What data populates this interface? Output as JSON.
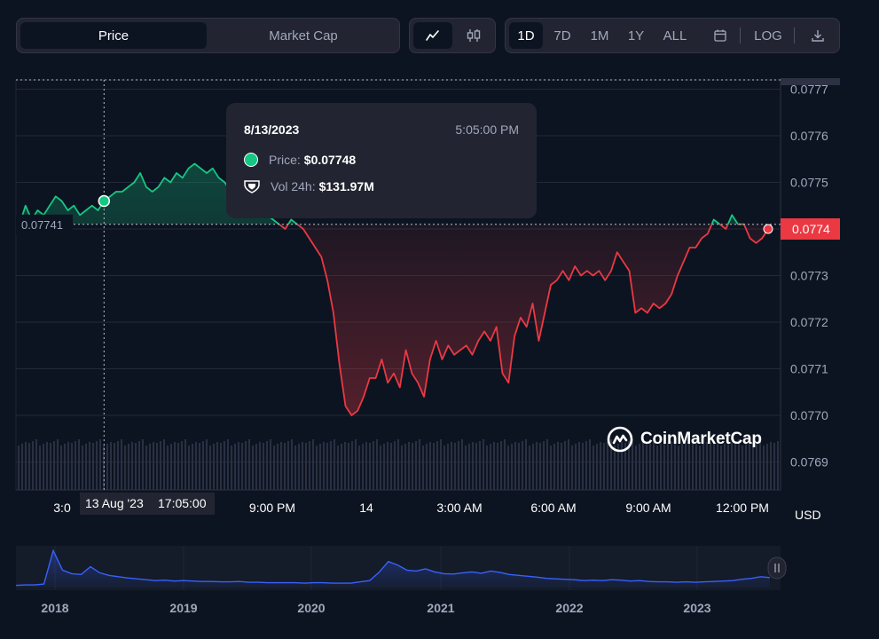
{
  "toolbar": {
    "type_tabs": [
      {
        "label": "Price",
        "active": true
      },
      {
        "label": "Market Cap",
        "active": false
      }
    ],
    "chart_type_buttons": [
      {
        "icon": "line-chart-icon",
        "active": true
      },
      {
        "icon": "candlestick-icon",
        "active": false
      }
    ],
    "range_tabs": [
      {
        "label": "1D",
        "active": true
      },
      {
        "label": "7D",
        "active": false
      },
      {
        "label": "1M",
        "active": false
      },
      {
        "label": "1Y",
        "active": false
      },
      {
        "label": "ALL",
        "active": false
      }
    ],
    "calendar_icon": "calendar-icon",
    "log_label": "LOG",
    "download_icon": "download-icon"
  },
  "tooltip": {
    "date": "8/13/2023",
    "time": "5:05:00 PM",
    "price_label": "Price:",
    "price_value": "$0.07748",
    "vol_label": "Vol 24h:",
    "vol_value": "$131.97M"
  },
  "watermark": "CoinMarketCap",
  "currency_label": "USD",
  "colors": {
    "background": "#0d1421",
    "panel": "#222531",
    "up": "#16c784",
    "down": "#ea3943",
    "nav_line": "#3861fb"
  },
  "chart_data": [
    {
      "type": "line",
      "title": "",
      "ylim": [
        0.07684,
        0.07772
      ],
      "yticks": [
        0.0769,
        0.077,
        0.0771,
        0.0772,
        0.0773,
        0.0774,
        0.0775,
        0.0776,
        0.0777
      ],
      "xticks": [
        "3:0",
        "9:00 PM",
        "14",
        "3:00 AM",
        "6:00 AM",
        "9:00 AM",
        "12:00 PM"
      ],
      "y_axis_position": "right",
      "reference_price_label": "0.07741",
      "reference_price": 0.07741,
      "current_price_label": "0.0774",
      "current_price": 0.0774,
      "crosshair_label": "13 Aug '23",
      "crosshair_time": "17:05:00",
      "series": [
        {
          "values": [
            0.07741,
            0.07745,
            0.07742,
            0.07744,
            0.07743,
            0.07745,
            0.07747,
            0.07746,
            0.07744,
            0.07745,
            0.07743,
            0.07744,
            0.07745,
            0.07744,
            0.07746,
            0.07747,
            0.07748,
            0.07748,
            0.07749,
            0.0775,
            0.07752,
            0.07749,
            0.07748,
            0.07749,
            0.07751,
            0.0775,
            0.07752,
            0.07751,
            0.07753,
            0.07754,
            0.07753,
            0.07752,
            0.07753,
            0.07751,
            0.0775,
            0.07748,
            0.07749,
            0.07747,
            0.07746,
            0.07745,
            0.07744,
            0.07743,
            0.07742,
            0.07741,
            0.0774,
            0.07742,
            0.07741,
            0.0774,
            0.07738,
            0.07736,
            0.07734,
            0.07729,
            0.07722,
            0.07711,
            0.07702,
            0.077,
            0.07701,
            0.07704,
            0.07708,
            0.07708,
            0.07712,
            0.07707,
            0.07709,
            0.07706,
            0.07714,
            0.07709,
            0.07707,
            0.07704,
            0.07712,
            0.07716,
            0.07712,
            0.07715,
            0.07713,
            0.07714,
            0.07715,
            0.07713,
            0.07716,
            0.07718,
            0.07716,
            0.07719,
            0.07709,
            0.07707,
            0.07717,
            0.07721,
            0.07719,
            0.07724,
            0.07716,
            0.07722,
            0.07728,
            0.07729,
            0.07731,
            0.07729,
            0.07732,
            0.0773,
            0.07731,
            0.0773,
            0.07731,
            0.07729,
            0.07731,
            0.07735,
            0.07733,
            0.07731,
            0.07722,
            0.07723,
            0.07722,
            0.07724,
            0.07723,
            0.07724,
            0.07726,
            0.0773,
            0.07733,
            0.07736,
            0.07736,
            0.07738,
            0.07739,
            0.07742,
            0.07741,
            0.0774,
            0.07743,
            0.07741,
            0.07741,
            0.07738,
            0.07737,
            0.07738,
            0.0774
          ]
        }
      ]
    },
    {
      "type": "area",
      "title": "",
      "xticks": [
        "2018",
        "2019",
        "2020",
        "2021",
        "2022",
        "2023"
      ],
      "series": [
        {
          "values": [
            0.5,
            0.6,
            0.6,
            0.8,
            8.5,
            4.0,
            3.2,
            3.0,
            4.8,
            3.4,
            2.8,
            2.5,
            2.2,
            2.0,
            1.8,
            1.6,
            1.7,
            1.5,
            1.6,
            1.5,
            1.4,
            1.4,
            1.3,
            1.3,
            1.4,
            1.2,
            1.2,
            1.1,
            1.1,
            1.1,
            1.1,
            1.0,
            1.1,
            1.1,
            1.0,
            1.0,
            1.0,
            1.3,
            1.6,
            3.5,
            6.0,
            5.2,
            4.0,
            3.8,
            4.3,
            3.6,
            3.2,
            3.1,
            3.4,
            3.6,
            3.3,
            3.8,
            3.5,
            3.0,
            2.8,
            2.6,
            2.4,
            2.1,
            2.0,
            1.9,
            1.8,
            1.6,
            1.7,
            1.6,
            1.8,
            1.7,
            1.5,
            1.6,
            1.4,
            1.3,
            1.3,
            1.2,
            1.3,
            1.2,
            1.3,
            1.4,
            1.5,
            1.6,
            1.9,
            2.1,
            2.5,
            2.3
          ]
        }
      ]
    }
  ]
}
